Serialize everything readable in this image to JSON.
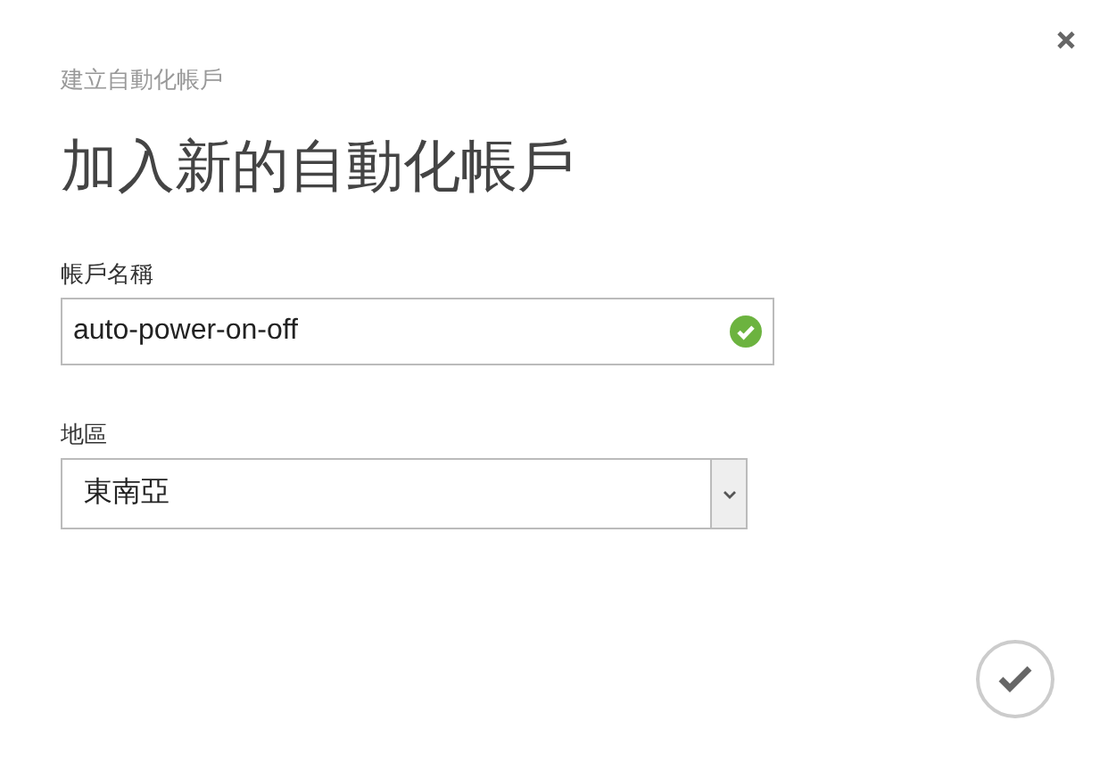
{
  "dialog": {
    "subtitle": "建立自動化帳戶",
    "title": "加入新的自動化帳戶"
  },
  "fields": [
    {
      "kind": "text",
      "label": "帳戶名稱",
      "value": "auto-power-on-off",
      "valid": true
    },
    {
      "kind": "select",
      "label": "地區",
      "value": "東南亞"
    }
  ]
}
